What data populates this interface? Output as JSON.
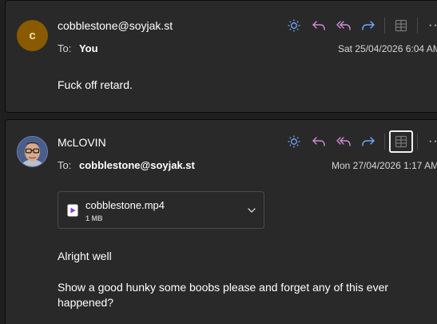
{
  "colors": {
    "sun_icon": "#6fa8ff",
    "reply_icon": "#d08bd6",
    "reply_all_icon": "#d08bd6",
    "forward_icon": "#6fa8ff",
    "avatar_c_bg": "#8a5a00"
  },
  "messages": [
    {
      "avatar_initial": "c",
      "sender": "cobblestone@soyjak.st",
      "to_label": "To:",
      "to_name": "You",
      "timestamp": "Sat 25/04/2026 6:04 AM",
      "body": "Fuck off retard.",
      "toolbar": {
        "icons": [
          "sun-icon",
          "reply-icon",
          "reply-all-icon",
          "forward-icon",
          "grid-icon",
          "more-icon"
        ]
      }
    },
    {
      "sender": "McLOVIN",
      "to_label": "To:",
      "to_name": "cobblestone@soyjak.st",
      "timestamp": "Mon 27/04/2026 1:17 AM",
      "attachment": {
        "name": "cobblestone.mp4",
        "size": "1 MB"
      },
      "body_line1": "Alright well",
      "body_line2": "Show a good hunky some boobs please and forget any of this ever happened?",
      "toolbar": {
        "icons": [
          "sun-icon",
          "reply-icon",
          "reply-all-icon",
          "forward-icon",
          "grid-icon",
          "more-icon"
        ]
      }
    }
  ]
}
